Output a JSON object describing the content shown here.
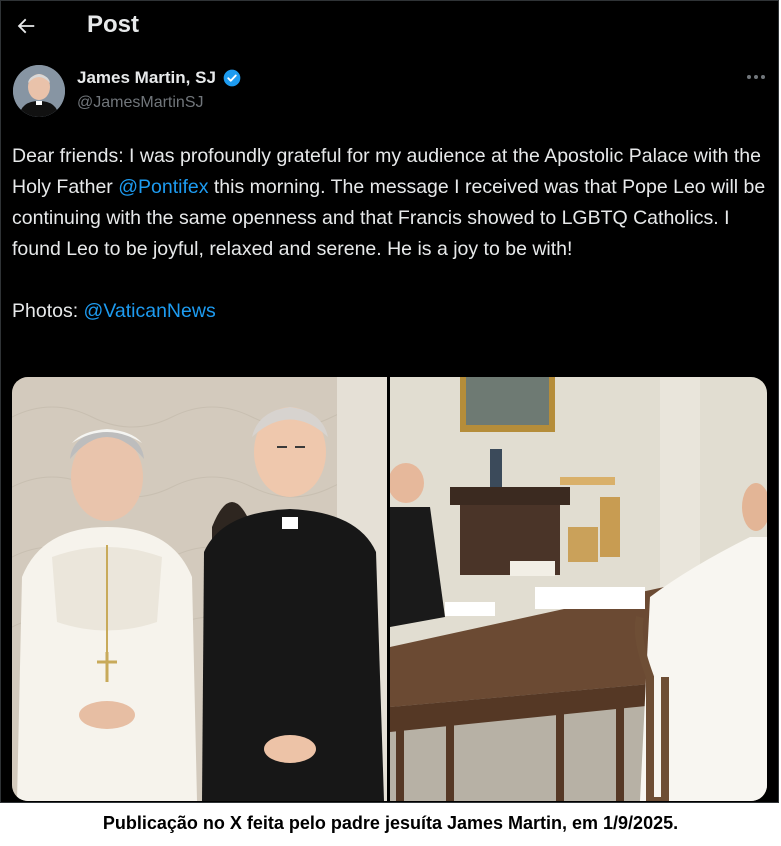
{
  "header": {
    "title": "Post"
  },
  "author": {
    "name": "James Martin, SJ",
    "handle": "@JamesMartinSJ",
    "verified": true
  },
  "post": {
    "text_parts": {
      "p1_before": "Dear friends: I was profoundly grateful for my audience at the Apostolic Palace with the Holy Father ",
      "p1_mention": "@Pontifex",
      "p1_after": "  this morning. The message I received was that Pope Leo will be continuing with the same openness and that Francis showed to LGBTQ Catholics. I found Leo to be joyful, relaxed and serene.  He is a joy to be with!",
      "p2_before": "Photos: ",
      "p2_mention": "@VaticanNews"
    }
  },
  "icons": {
    "back": "arrow-left-icon",
    "verified": "verified-badge-icon",
    "more": "more-horizontal-icon"
  },
  "colors": {
    "background": "#000000",
    "text": "#e7e9ea",
    "secondary": "#71767b",
    "link": "#1d9bf0"
  },
  "caption": "Publicação no X feita pelo padre jesuíta James Martin, em 1/9/2025."
}
